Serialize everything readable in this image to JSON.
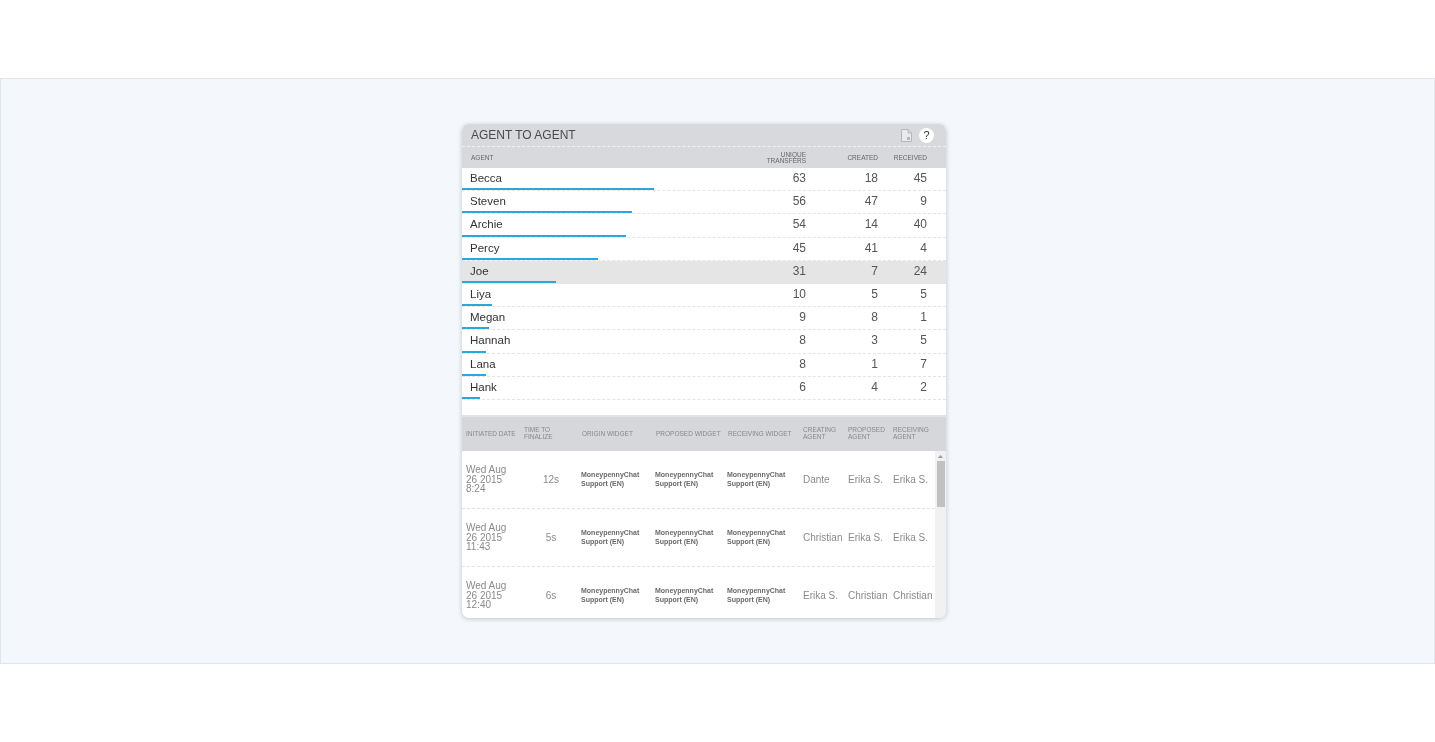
{
  "widget": {
    "title": "AGENT TO AGENT",
    "help_button": "?"
  },
  "summary_table": {
    "columns": [
      "AGENT",
      "UNIQUE TRANSFERS",
      "CREATED",
      "RECEIVED"
    ],
    "rows": [
      {
        "agent": "Becca",
        "unique_transfers": "63",
        "created": "18",
        "received": "45",
        "level": 0.397,
        "selected": false
      },
      {
        "agent": "Steven",
        "unique_transfers": "56",
        "created": "47",
        "received": "9",
        "level": 0.351,
        "selected": false
      },
      {
        "agent": "Archie",
        "unique_transfers": "54",
        "created": "14",
        "received": "40",
        "level": 0.339,
        "selected": false
      },
      {
        "agent": "Percy",
        "unique_transfers": "45",
        "created": "41",
        "received": "4",
        "level": 0.281,
        "selected": false
      },
      {
        "agent": "Joe",
        "unique_transfers": "31",
        "created": "7",
        "received": "24",
        "level": 0.194,
        "selected": true
      },
      {
        "agent": "Liya",
        "unique_transfers": "10",
        "created": "5",
        "received": "5",
        "level": 0.062,
        "selected": false
      },
      {
        "agent": "Megan",
        "unique_transfers": "9",
        "created": "8",
        "received": "1",
        "level": 0.056,
        "selected": false
      },
      {
        "agent": "Hannah",
        "unique_transfers": "8",
        "created": "3",
        "received": "5",
        "level": 0.05,
        "selected": false
      },
      {
        "agent": "Lana",
        "unique_transfers": "8",
        "created": "1",
        "received": "7",
        "level": 0.05,
        "selected": false
      },
      {
        "agent": "Hank",
        "unique_transfers": "6",
        "created": "4",
        "received": "2",
        "level": 0.037,
        "selected": false
      }
    ]
  },
  "transfers_table": {
    "columns": [
      "INITIATED DATE",
      "TIME TO FINALIZE",
      "ORIGIN WIDGET",
      "PROPOSED WIDGET",
      "RECEIVING WIDGET",
      "CREATING AGENT",
      "PROPOSED AGENT",
      "RECEIVING AGENT"
    ],
    "rows": [
      {
        "initiated_date": "Wed Aug 26 2015 8:24",
        "time_to_finalize": "12s",
        "origin_widget": "MoneypennyChat Support (EN)",
        "proposed_widget": "MoneypennyChat Support (EN)",
        "receiving_widget": "MoneypennyChat Support (EN)",
        "creating_agent": "Dante",
        "proposed_agent": "Erika S.",
        "receiving_agent": "Erika S."
      },
      {
        "initiated_date": "Wed Aug 26 2015 11:43",
        "time_to_finalize": "5s",
        "origin_widget": "MoneypennyChat Support (EN)",
        "proposed_widget": "MoneypennyChat Support (EN)",
        "receiving_widget": "MoneypennyChat Support (EN)",
        "creating_agent": "Christian",
        "proposed_agent": "Erika S.",
        "receiving_agent": "Erika S."
      },
      {
        "initiated_date": "Wed Aug 26 2015 12:40",
        "time_to_finalize": "6s",
        "origin_widget": "MoneypennyChat Support (EN)",
        "proposed_widget": "MoneypennyChat Support (EN)",
        "receiving_widget": "MoneypennyChat Support (EN)",
        "creating_agent": "Erika S.",
        "proposed_agent": "Christian",
        "receiving_agent": "Christian"
      }
    ]
  }
}
